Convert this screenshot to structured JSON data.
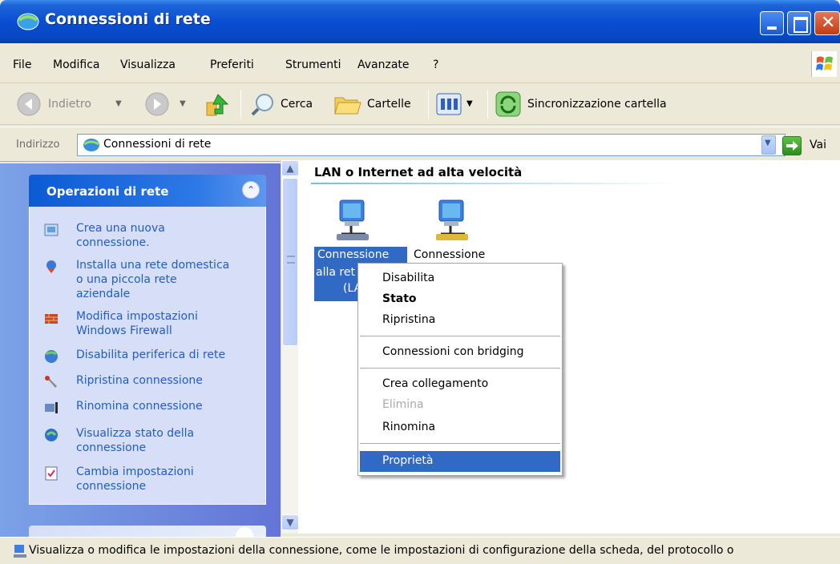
{
  "window": {
    "title": "Connessioni di rete"
  },
  "menu": [
    "File",
    "Modifica",
    "Visualizza",
    "Preferiti",
    "Strumenti",
    "Avanzate",
    "?"
  ],
  "toolbar": {
    "back_label": "Indietro",
    "search_label": "Cerca",
    "folders_label": "Cartelle",
    "sync_label": "Sincronizzazione cartella"
  },
  "address": {
    "label": "Indirizzo",
    "value": "Connessioni di rete",
    "go_label": "Vai"
  },
  "taskpane": {
    "title": "Operazioni di rete",
    "tasks": [
      {
        "label": "Crea una nuova\nconnessione.",
        "icon": "new-connection-icon"
      },
      {
        "label": "Installa una rete domestica\no una piccola rete\naziendale",
        "icon": "home-network-icon"
      },
      {
        "label": "Modifica impostazioni\nWindows Firewall",
        "icon": "firewall-icon"
      },
      {
        "label": "Disabilita periferica di rete",
        "icon": "disable-device-icon"
      },
      {
        "label": "Ripristina connessione",
        "icon": "repair-icon"
      },
      {
        "label": "Rinomina connessione",
        "icon": "rename-icon"
      },
      {
        "label": "Visualizza stato della\nconnessione",
        "icon": "status-icon"
      },
      {
        "label": "Cambia impostazioni\nconnessione",
        "icon": "settings-icon"
      }
    ]
  },
  "content": {
    "group_title": "LAN o Internet ad alta velocità",
    "connections": [
      {
        "label_line1": "Connessione",
        "label_line2": "alla ret",
        "label_line3": "(LA",
        "selected": true
      },
      {
        "label_line1": "Connessione",
        "selected": false
      }
    ]
  },
  "context_menu": {
    "items": [
      {
        "label": "Disabilita",
        "style": "normal"
      },
      {
        "label": "Stato",
        "style": "bold"
      },
      {
        "label": "Ripristina",
        "style": "normal"
      },
      {
        "label": "Connessioni con bridging",
        "style": "normal"
      },
      {
        "label": "Crea collegamento",
        "style": "normal"
      },
      {
        "label": "Elimina",
        "style": "disabled"
      },
      {
        "label": "Rinomina",
        "style": "normal"
      },
      {
        "label": "Proprietà",
        "style": "highlighted"
      }
    ]
  },
  "status": {
    "text": "Visualizza o modifica le impostazioni della connessione, come le impostazioni di configurazione della scheda, del protocollo o"
  },
  "colors": {
    "title_blue": "#0a4ed2",
    "selection": "#316ac5",
    "task_link": "#215dc6"
  }
}
